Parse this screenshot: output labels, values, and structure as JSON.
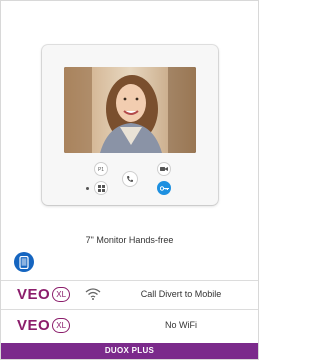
{
  "product": {
    "caption": "7\" Monitor Hands-free",
    "image_alt": "woman-smiling-on-screen"
  },
  "features": [
    {
      "brand": "VEO",
      "badge": "XL",
      "icon": "wifi-icon",
      "label": "Call Divert to Mobile"
    },
    {
      "brand": "VEO",
      "badge": "XL",
      "icon": "",
      "label": "No WiFi"
    }
  ],
  "footer": {
    "label": "DUOX PLUS"
  },
  "colors": {
    "brand": "#8b1d6b",
    "footer_bg": "#7b2a8b",
    "app_badge": "#1565c0",
    "accent_button": "#1e90e0"
  },
  "icons": {
    "app_badge": "mobile-app-icon",
    "buttons": [
      "p1-icon",
      "camera-icon",
      "hands-free-icon",
      "grid-icon",
      "key-icon"
    ]
  }
}
